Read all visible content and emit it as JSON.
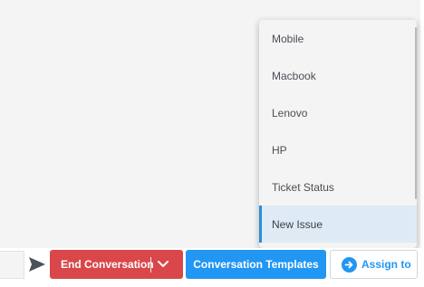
{
  "dropdown": {
    "items": [
      {
        "label": "Mobile"
      },
      {
        "label": "Macbook"
      },
      {
        "label": "Lenovo"
      },
      {
        "label": "HP"
      },
      {
        "label": "Ticket Status"
      },
      {
        "label": "New Issue"
      }
    ],
    "active_item": "New Issue"
  },
  "actions": {
    "end_conversation_label": "End Conversation",
    "conversation_templates_label": "Conversation Templates",
    "assign_to_label": "Assign to"
  },
  "icons": {
    "send": "send-icon",
    "end_menu": "chevron-down-icon",
    "assign": "arrow-right-circle-icon"
  },
  "colors": {
    "end_button": "#d9474a",
    "primary": "#2196f3",
    "active_item_bg": "#deebf5",
    "active_item_accent": "#2a8dd6"
  }
}
